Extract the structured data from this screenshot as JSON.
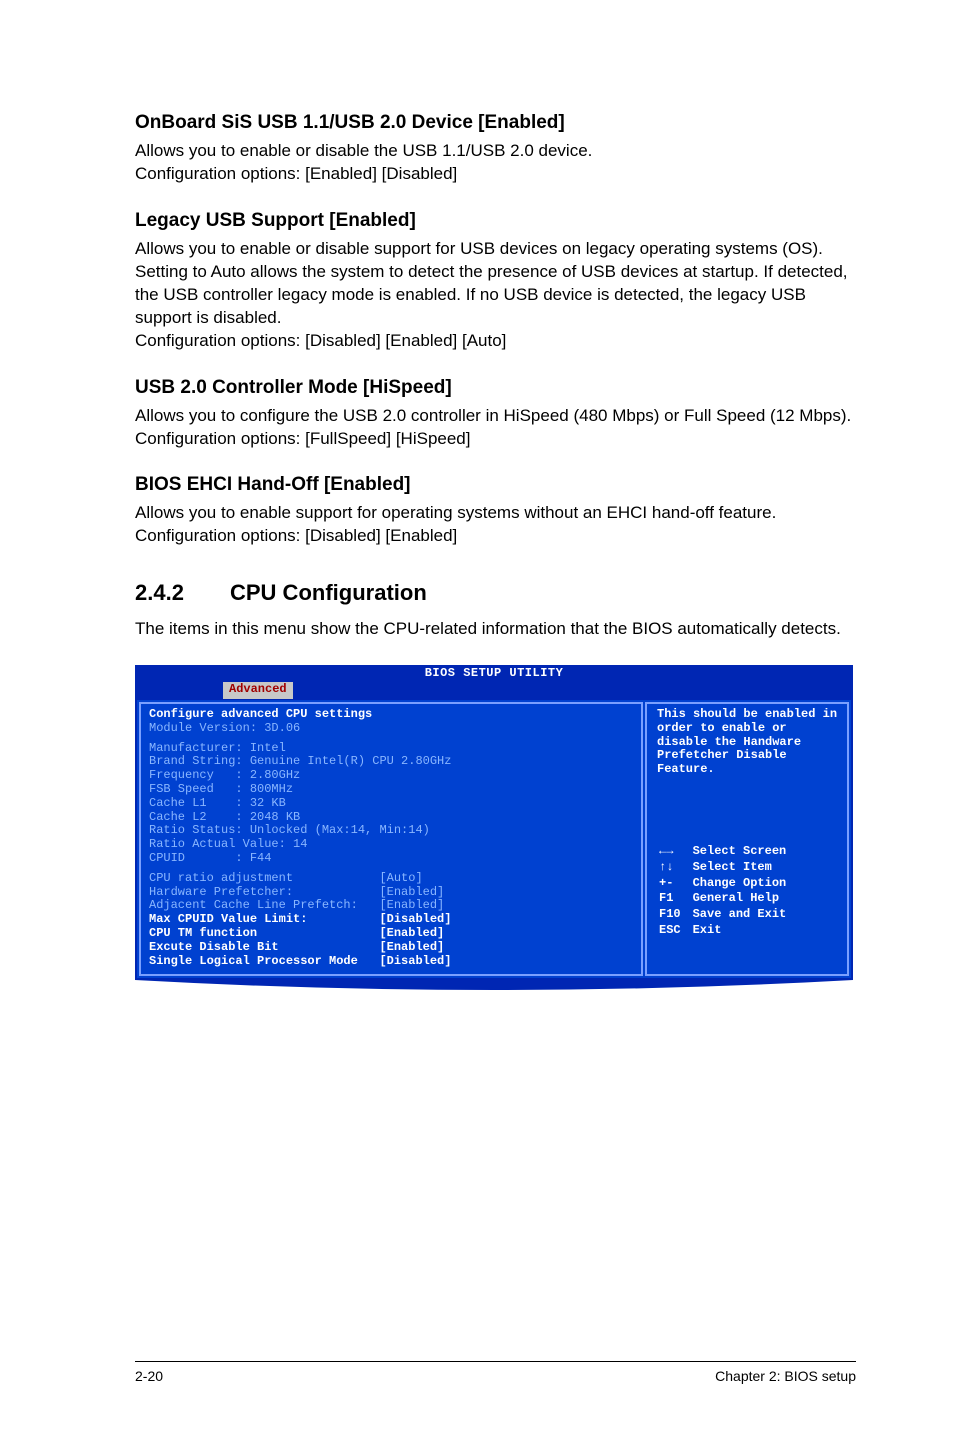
{
  "sections": {
    "s1": {
      "heading": "OnBoard SiS USB 1.1/USB 2.0 Device [Enabled]",
      "body": "Allows you to enable or disable the USB 1.1/USB 2.0 device.\nConfiguration options: [Enabled] [Disabled]"
    },
    "s2": {
      "heading": "Legacy USB Support [Enabled]",
      "body": "Allows you to enable or disable support for USB devices on legacy operating systems (OS). Setting to Auto allows the system to detect the presence of USB devices at startup. If detected, the USB controller legacy mode is enabled. If no USB device is detected, the legacy USB support is disabled.\nConfiguration options: [Disabled] [Enabled] [Auto]"
    },
    "s3": {
      "heading": "USB 2.0 Controller Mode [HiSpeed]",
      "body": "Allows you to configure the USB 2.0 controller in HiSpeed (480 Mbps) or Full Speed (12 Mbps). Configuration options: [FullSpeed] [HiSpeed]"
    },
    "s4": {
      "heading": "BIOS EHCI Hand-Off [Enabled]",
      "body": "Allows you to enable support for operating systems without an EHCI hand-off feature. Configuration options: [Disabled] [Enabled]"
    },
    "s5": {
      "num": "2.4.2",
      "title": "CPU Configuration",
      "body": "The items in this menu show the CPU-related information that the BIOS automatically detects."
    }
  },
  "bios": {
    "title": "BIOS SETUP UTILITY",
    "tab": "Advanced",
    "cfg_head": "Configure advanced CPU settings",
    "module_ver": "Module Version: 3D.06",
    "info_lines": [
      "Manufacturer: Intel",
      "Brand String: Genuine Intel(R) CPU 2.80GHz",
      "Frequency   : 2.80GHz",
      "FSB Speed   : 800MHz",
      "Cache L1    : 32 KB",
      "Cache L2    : 2048 KB",
      "Ratio Status: Unlocked (Max:14, Min:14)",
      "Ratio Actual Value: 14",
      "CPUID       : F44"
    ],
    "items": [
      {
        "label": "CPU ratio adjustment",
        "value": "[Auto]",
        "style": "item"
      },
      {
        "label": "Hardware Prefetcher:",
        "value": "[Enabled]",
        "style": "item"
      },
      {
        "label": "Adjacent Cache Line Prefetch:",
        "value": "[Enabled]",
        "style": "item"
      },
      {
        "label": "Max CPUID Value Limit:",
        "value": "[Disabled]",
        "style": "item-white"
      },
      {
        "label": "CPU TM function",
        "value": "[Enabled]",
        "style": "item-white"
      },
      {
        "label": "Excute Disable Bit",
        "value": "[Enabled]",
        "style": "item-white"
      },
      {
        "label": "Single Logical Processor Mode",
        "value": "[Disabled]",
        "style": "item-white"
      }
    ],
    "help": "This should be enabled in order to enable or disable the Handware Prefetcher Disable Feature.",
    "legend": [
      {
        "key": "←→",
        "text": "Select Screen"
      },
      {
        "key": "↑↓",
        "text": "Select Item"
      },
      {
        "key": "+-",
        "text": "Change Option"
      },
      {
        "key": "F1",
        "text": "General Help"
      },
      {
        "key": "F10",
        "text": "Save and Exit"
      },
      {
        "key": "ESC",
        "text": "Exit"
      }
    ]
  },
  "footer": {
    "left": "2-20",
    "right": "Chapter 2: BIOS setup"
  }
}
